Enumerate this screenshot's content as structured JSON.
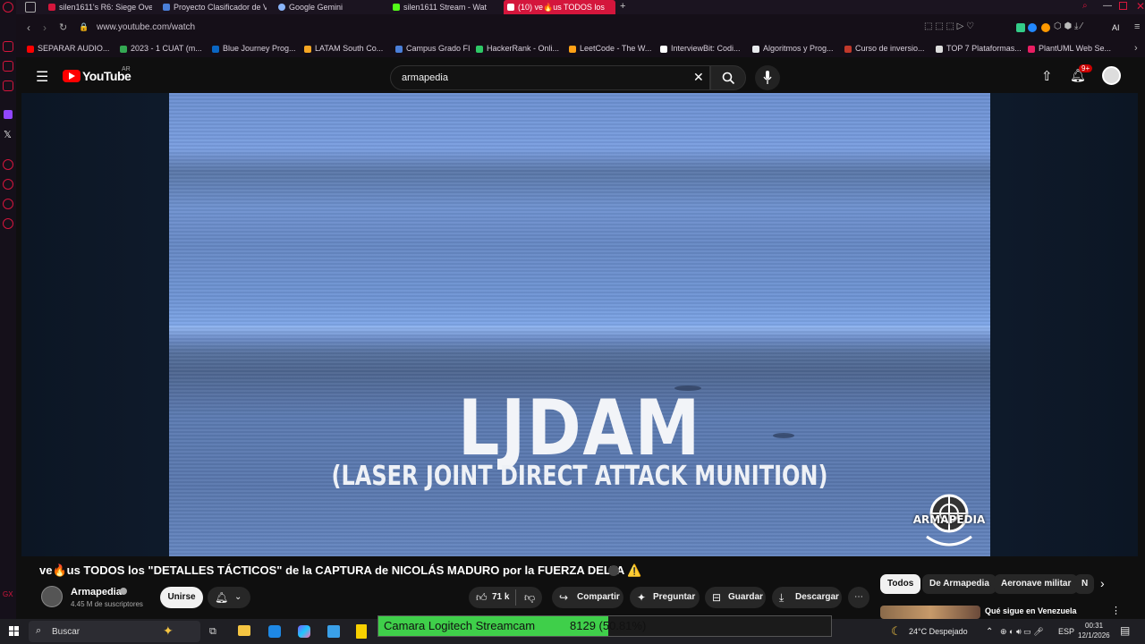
{
  "browser": {
    "tabs": [
      {
        "label": "silen1611's R6: Siege Over",
        "color": "#d4163c"
      },
      {
        "label": "Proyecto Clasificador de V",
        "color": "#4a7fd8"
      },
      {
        "label": "Google Gemini",
        "color": "#8ab4f8"
      },
      {
        "label": "silen1611 Stream - Wat",
        "color": "#53fc18"
      },
      {
        "label": "(10) ve🔥us TODOS los",
        "color": "#ffffff"
      }
    ],
    "url": "www.youtube.com/watch",
    "bookmarks": [
      {
        "label": "SEPARAR AUDIO...",
        "color": "#ff0000"
      },
      {
        "label": "2023 - 1 CUAT (m...",
        "color": "#34a853"
      },
      {
        "label": "Blue Journey Prog...",
        "color": "#0a66c2"
      },
      {
        "label": "LATAM South Co...",
        "color": "#f5a623"
      },
      {
        "label": "Campus Grado FI",
        "color": "#4a7fd8"
      },
      {
        "label": "HackerRank - Onli...",
        "color": "#2ec866"
      },
      {
        "label": "LeetCode - The W...",
        "color": "#ffa116"
      },
      {
        "label": "InterviewBit: Codi...",
        "color": "#ffffff"
      },
      {
        "label": "Algoritmos y Prog...",
        "color": "#e8eaed"
      },
      {
        "label": "Curso de inversio...",
        "color": "#c0392b"
      },
      {
        "label": "TOP 7 Plataformas...",
        "color": "#dddddd"
      },
      {
        "label": "PlantUML Web Se...",
        "color": "#e91e63"
      }
    ],
    "extensions_label": "AI"
  },
  "youtube": {
    "logo_text": "YouTube",
    "region": "AR",
    "search_value": "armapedia",
    "notifications_badge": "9+"
  },
  "video": {
    "overlay_title": "LJDAM",
    "overlay_subtitle": "(LASER JOINT DIRECT ATTACK MUNITION)",
    "watermark_text": "ARMAPEDIA",
    "title": "ve🔥us TODOS los \"DETALLES TÁCTICOS\" de la CAPTURA de NICOLÁS MADURO por la FUERZA DELTA ⚠️"
  },
  "channel": {
    "name": "Armapedia",
    "subscribers": "4.45 M de suscriptores",
    "join_label": "Unirse"
  },
  "actions": {
    "likes": "71 k",
    "share": "Compartir",
    "ask": "Preguntar",
    "save": "Guardar",
    "download": "Descargar"
  },
  "chips": [
    "Todos",
    "De Armapedia",
    "Aeronave militar",
    "N"
  ],
  "recommended": {
    "title": "Qué sigue en Venezuela"
  },
  "overlay_camera": {
    "label": "Camara Logitech Streamcam",
    "value": "8129",
    "percent_text": "(50.81%)",
    "fill_fraction": 0.5081
  },
  "taskbar": {
    "search_placeholder": "Buscar",
    "weather": "24°C  Despejado",
    "lang": "ESP",
    "time": "00:31",
    "date": "12/1/2026"
  }
}
